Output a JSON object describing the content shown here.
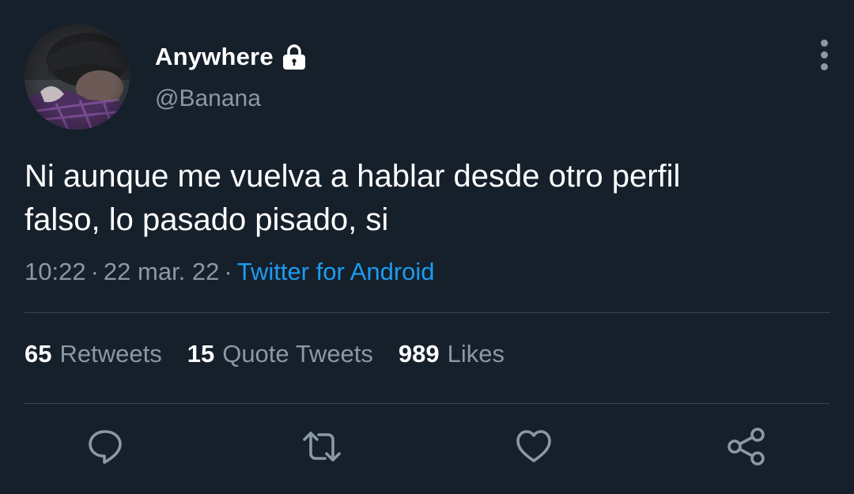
{
  "user": {
    "display_name": "Anywhere",
    "handle": "@Banana",
    "protected_icon": "lock-icon"
  },
  "tweet": {
    "text": "Ni aunque me vuelva a hablar desde otro perfil\nfalso, lo pasado pisado, si",
    "time": "10:22",
    "date": "22 mar. 22",
    "separator": "·",
    "source": "Twitter for Android"
  },
  "stats": {
    "retweets_count": "65",
    "retweets_label": "Retweets",
    "quotes_count": "15",
    "quotes_label": "Quote Tweets",
    "likes_count": "989",
    "likes_label": "Likes"
  },
  "actions": {
    "reply_icon": "reply-icon",
    "retweet_icon": "retweet-icon",
    "like_icon": "heart-icon",
    "share_icon": "share-icon"
  },
  "colors": {
    "background": "#15202b",
    "primary_text": "#ffffff",
    "secondary_text": "#8b98a5",
    "link": "#1d9bf0",
    "divider": "#38444d"
  }
}
